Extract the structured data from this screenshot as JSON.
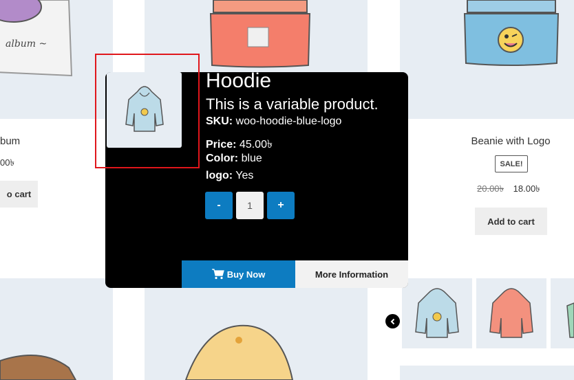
{
  "products": {
    "album": {
      "name_partial": "bum",
      "price_partial": "00৳",
      "cart_partial": "o cart"
    },
    "beanie_logo": {
      "name": "Beanie with Logo",
      "sale_badge": "SALE!",
      "old_price": "20.00৳",
      "new_price": "18.00৳",
      "cart_label": "Add to cart"
    }
  },
  "popup": {
    "title": "Hoodie",
    "description": "This is a variable product.",
    "sku_label": "SKU:",
    "sku_value": "woo-hoodie-blue-logo",
    "price_label": "Price:",
    "price_value": "45.00৳",
    "color_label": "Color:",
    "color_value": "blue",
    "logo_label": "logo:",
    "logo_value": "Yes",
    "qty_minus": "-",
    "qty_value": "1",
    "qty_plus": "+",
    "buy_now_label": "Buy Now",
    "more_info_label": "More Information"
  },
  "icons": {
    "cart": "cart-icon",
    "nav": "chevron-left-icon"
  },
  "colors": {
    "accent": "#0d7cc1",
    "popup_bg": "#000000",
    "highlight": "#e0161b",
    "tile_bg": "#e7edf3"
  }
}
